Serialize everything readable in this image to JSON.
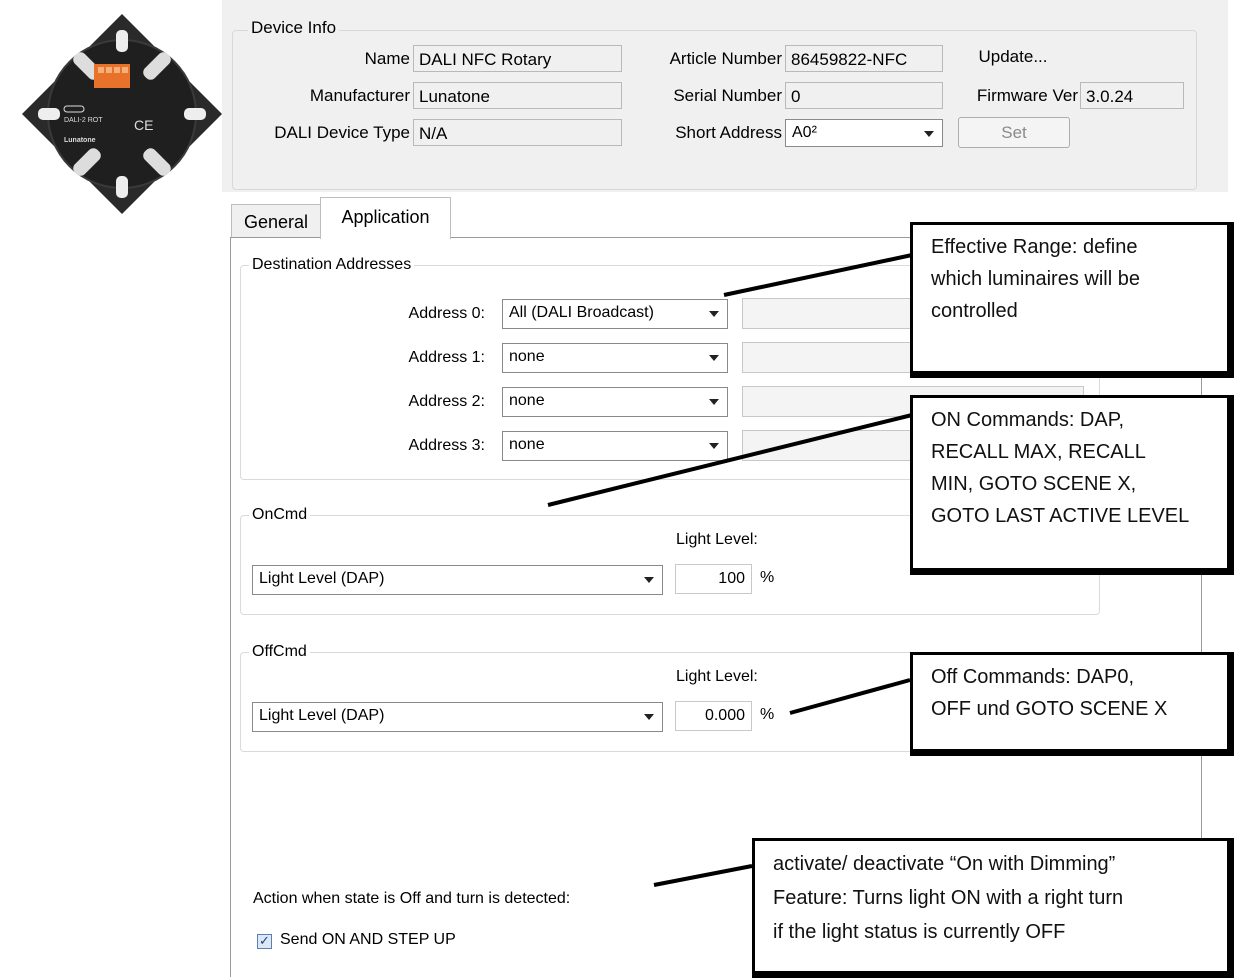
{
  "device_info": {
    "title": "Device Info",
    "name_label": "Name",
    "name_value": "DALI NFC Rotary",
    "manufacturer_label": "Manufacturer",
    "manufacturer_value": "Lunatone",
    "device_type_label": "DALI Device Type",
    "device_type_value": "N/A",
    "article_label": "Article Number",
    "article_value": "86459822-NFC",
    "serial_label": "Serial Number",
    "serial_value": "0",
    "short_address_label": "Short Address",
    "short_address_value": "A0²",
    "update_label": "Update...",
    "firmware_label": "Firmware Ver",
    "firmware_value": "3.0.24",
    "set_label": "Set"
  },
  "device_image": {
    "brand": "Lunatone",
    "model": "DALI-2 ROT",
    "mark": "CE"
  },
  "tabs": [
    {
      "label": "General",
      "active": false
    },
    {
      "label": "Application",
      "active": true
    }
  ],
  "destination": {
    "title": "Destination Addresses",
    "rows": [
      {
        "label": "Address 0:",
        "value": "All (DALI Broadcast)"
      },
      {
        "label": "Address 1:",
        "value": "none"
      },
      {
        "label": "Address 2:",
        "value": "none"
      },
      {
        "label": "Address 3:",
        "value": "none"
      }
    ]
  },
  "oncmd": {
    "title": "OnCmd",
    "light_level_label": "Light Level:",
    "command": "Light Level (DAP)",
    "value": "100",
    "unit": "%"
  },
  "offcmd": {
    "title": "OffCmd",
    "light_level_label": "Light Level:",
    "command": "Light Level (DAP)",
    "value": "0.000",
    "unit": "%"
  },
  "turn_action": {
    "label": "Action when state is Off and turn is detected:",
    "checkbox_label": "Send ON AND STEP UP",
    "checked": true
  },
  "callouts": {
    "range": [
      "Effective Range: define",
      "which luminaires will be",
      "controlled"
    ],
    "on": [
      "ON Commands: DAP,",
      "RECALL MAX, RECALL",
      "MIN, GOTO SCENE X,",
      "GOTO LAST ACTIVE LEVEL"
    ],
    "off": [
      "Off Commands: DAP0,",
      "OFF und GOTO SCENE X"
    ],
    "dimming": [
      "activate/ deactivate “On with Dimming”",
      "Feature: Turns light ON with a right turn",
      "if the light status is currently OFF"
    ]
  },
  "colors": {
    "panel_bg": "#f0f0f0",
    "terminal_orange": "#e8722a",
    "device_body": "#2a2a2a"
  }
}
